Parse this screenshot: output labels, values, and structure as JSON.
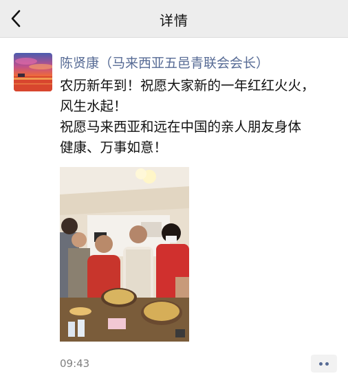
{
  "header": {
    "title": "详情",
    "back_icon": "chevron-left-icon"
  },
  "post": {
    "author": "陈贤康（马来西亚五邑青联会会长）",
    "text_lines": [
      "农历新年到！祝愿大家新的一年红红火火，",
      "风生水起！",
      "祝愿马来西亚和远在中国的亲人朋友身体",
      "健康、万事如意！"
    ],
    "time": "09:43",
    "more_icon": "more-dots-icon"
  },
  "colors": {
    "author_link": "#576b95",
    "header_bg": "#ededed",
    "time_text": "#7f7f7f"
  }
}
